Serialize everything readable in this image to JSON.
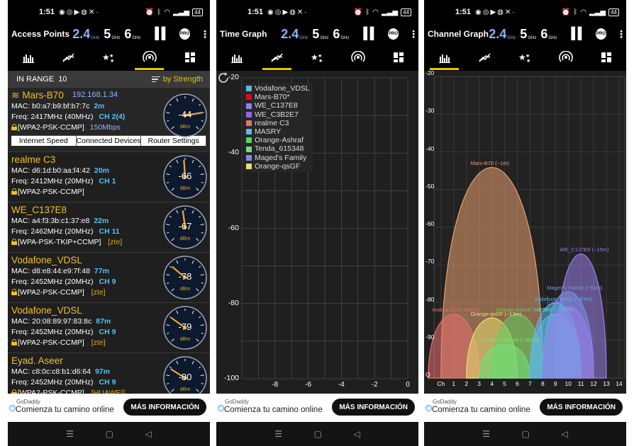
{
  "status": {
    "time": "1:51",
    "battery": "44"
  },
  "bands": [
    "2.4",
    "5",
    "6"
  ],
  "ghz": "GHz",
  "screens": {
    "access_points": {
      "title": "Access Points"
    },
    "time_graph": {
      "title": "Time Graph"
    },
    "channel_graph": {
      "title": "Channel Graph"
    }
  },
  "in_range": {
    "label": "IN RANGE",
    "count": "10",
    "sort": "by Strength"
  },
  "access_points": [
    {
      "ssid": "Mars-B70",
      "ip": "192.168.1.34",
      "mac": "MAC: b0:a7:b9:bf:b7:7c",
      "dist": "2m",
      "freq": "Freq: 2417MHz (40MHz)",
      "ch": "CH 2(4)",
      "sec": "[WPA2-PSK-CCMP]",
      "vendor": "",
      "speed": "150Mbps",
      "dbm": -44
    },
    {
      "ssid": "realme C3",
      "ip": "",
      "mac": "MAC: d6:1d:b0:aa:f4:42",
      "dist": "20m",
      "freq": "Freq: 2412MHz (20MHz)",
      "ch": "CH 1",
      "sec": "[WPA2-PSK-CCMP]",
      "vendor": "",
      "speed": "",
      "dbm": -66
    },
    {
      "ssid": "WE_C137E8",
      "ip": "",
      "mac": "MAC: a4:f3:3b:c1:37:e8",
      "dist": "22m",
      "freq": "Freq: 2462MHz (20MHz)",
      "ch": "CH 11",
      "sec": "[WPA-PSK-TKIP+CCMP]",
      "vendor": "[zte]",
      "speed": "",
      "dbm": -67
    },
    {
      "ssid": "Vodafone_VDSL",
      "ip": "",
      "mac": "MAC: d8:e8:44:e9:7f:48",
      "dist": "77m",
      "freq": "Freq: 2452MHz (20MHz)",
      "ch": "CH 9",
      "sec": "[WPA2-PSK-CCMP]",
      "vendor": "[zte]",
      "speed": "",
      "dbm": -78
    },
    {
      "ssid": "Vodafone_VDSL",
      "ip": "",
      "mac": "MAC: 20:08:89:97:83:8c",
      "dist": "87m",
      "freq": "Freq: 2452MHz (20MHz)",
      "ch": "CH 9",
      "sec": "[WPA2-PSK-CCMP]",
      "vendor": "[zte]",
      "speed": "",
      "dbm": -79
    },
    {
      "ssid": "Eyad. Aseer",
      "ip": "",
      "mac": "MAC: c8:0c:c8:b1:d6:64",
      "dist": "97m",
      "freq": "Freq: 2452MHz (20MHz)",
      "ch": "CH 9",
      "sec": "[WPA2-PSK-CCMP]",
      "vendor": "[HUAWEI]",
      "speed": "",
      "dbm": -80
    }
  ],
  "gauge_unit": "dBm",
  "actions": [
    "Internet Speed",
    "Connected Devices",
    "Router Settings"
  ],
  "ad": {
    "brand": "GoDaddy",
    "text": "Comienza tu camino online",
    "cta": "MÁS INFORMACIÓN"
  },
  "colors": {
    "accent": "#e6c500",
    "ssid": "#f0c020",
    "channel": "#4fc3f7",
    "band_active": "#8ab4f8"
  },
  "chart_data": [
    {
      "type": "line",
      "y_ticks": [
        "-20",
        "-40",
        "-60",
        "-80",
        "-100"
      ],
      "x_ticks": [
        "-8",
        "-6",
        "-4",
        "-2",
        "0"
      ],
      "ylim": [
        -100,
        -20
      ],
      "xlim": [
        -10,
        0
      ],
      "legend": [
        {
          "name": "Vodafone_VDSL",
          "color": "#5bb8e8"
        },
        {
          "name": "Mars-B70*",
          "color": "#e8002a"
        },
        {
          "name": "WE_C137E8",
          "color": "#9a7de8"
        },
        {
          "name": "WE_C3B2E7",
          "color": "#8a6be0"
        },
        {
          "name": "realme C3",
          "color": "#e87070"
        },
        {
          "name": "MASRY",
          "color": "#5bb8e8"
        },
        {
          "name": "Orange-Ashraf",
          "color": "#5ed05e"
        },
        {
          "name": "Tenda_615348",
          "color": "#6ee07a"
        },
        {
          "name": "Maged's Family",
          "color": "#7b8ee8"
        },
        {
          "name": "Orange-qsGF",
          "color": "#e8e070"
        }
      ]
    },
    {
      "type": "area",
      "x_ticks": [
        "Ch",
        "1",
        "2",
        "3",
        "4",
        "5",
        "6",
        "7",
        "8",
        "9",
        "10",
        "11",
        "12",
        "13",
        "14"
      ],
      "y_ticks": [
        "-20",
        "-30",
        "-40",
        "-50",
        "-60",
        "-70",
        "-80",
        "-90",
        "Q"
      ],
      "ylim": [
        -100,
        -20
      ],
      "series": [
        {
          "name": "Mars-B70 (~1m)",
          "center": 4,
          "width": 4,
          "peak": -44,
          "color": "#e8a070"
        },
        {
          "name": "realme C3 (~124m)",
          "center": 1,
          "width": 2,
          "peak": -83,
          "color": "#e87070"
        },
        {
          "name": "Orange-qsGF (~13m)",
          "center": 4,
          "width": 2,
          "peak": -84,
          "color": "#e8e070"
        },
        {
          "name": "Orange-Ashraf (~128m)",
          "center": 6,
          "width": 2,
          "peak": -83,
          "color": "#5ed05e"
        },
        {
          "name": "Tenda_615348 (~300m)",
          "center": 5,
          "width": 2,
          "peak": -91,
          "color": "#6ee07a"
        },
        {
          "name": "WE_C137E8 (~15m)",
          "center": 11,
          "width": 2,
          "peak": -67,
          "color": "#9a7de8"
        },
        {
          "name": "Maged's Family (~61m)",
          "center": 10,
          "width": 2,
          "peak": -77,
          "color": "#7b8ee8"
        },
        {
          "name": "Vodafone_VDSL (~87m)",
          "center": 9,
          "width": 2,
          "peak": -80,
          "color": "#5bb8e8"
        },
        {
          "name": "MASRY (~157m)",
          "center": 9,
          "width": 2,
          "peak": -83,
          "color": "#5bb8e8"
        },
        {
          "name": "(~94m)",
          "center": 10,
          "width": 2,
          "peak": -81,
          "color": "#9a7de8"
        }
      ]
    }
  ]
}
